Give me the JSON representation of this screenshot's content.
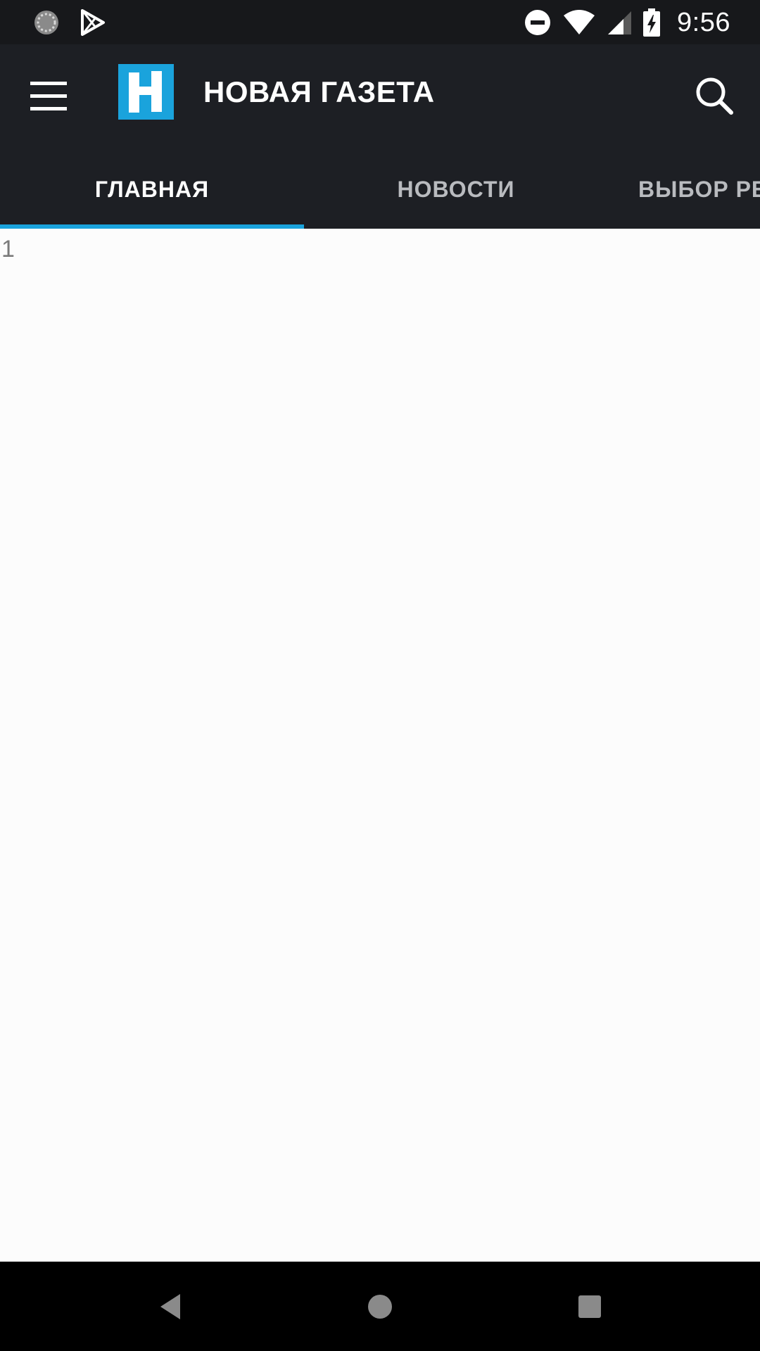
{
  "status_bar": {
    "time": "9:56",
    "icons": [
      "sync-icon",
      "play-store-icon",
      "do-not-disturb-icon",
      "wifi-icon",
      "signal-icon",
      "battery-charging-icon"
    ]
  },
  "app_bar": {
    "title": "НОВАЯ ГАЗЕТА",
    "logo_letter": "Н",
    "menu_icon": "hamburger-menu-icon",
    "search_icon": "search-icon",
    "logo_color": "#1aa3dc",
    "background": "#1d1f24"
  },
  "tabs": [
    {
      "label": "ГЛАВНАЯ",
      "active": true
    },
    {
      "label": "НОВОСТИ",
      "active": false
    },
    {
      "label": "ВЫБОР РЕДАКЦИИ",
      "active": false
    }
  ],
  "content": {
    "text": "1"
  },
  "nav_bar": {
    "icons": [
      "back-icon",
      "home-icon",
      "recents-icon"
    ]
  },
  "colors": {
    "accent": "#1aa3dc",
    "tab_inactive": "#b9bbbf",
    "content_bg": "#fcfcfc"
  }
}
